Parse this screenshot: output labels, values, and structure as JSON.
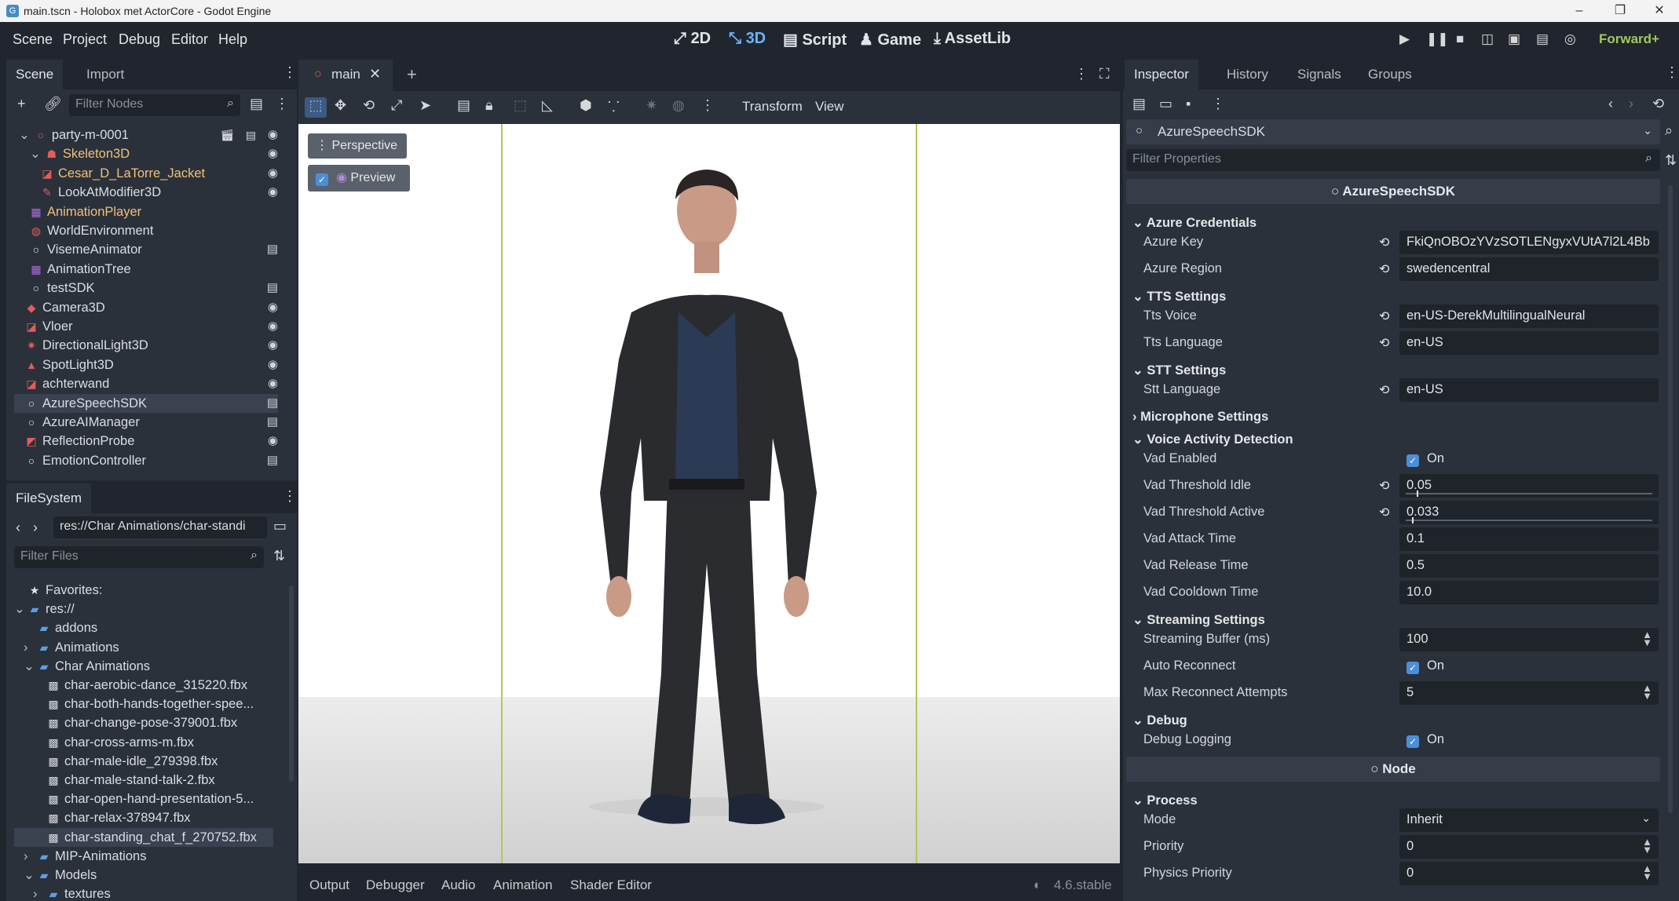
{
  "window": {
    "title": "main.tscn - Holobox met ActorCore - Godot Engine",
    "minimize": "–",
    "maximize": "❐",
    "close": "✕"
  },
  "menu": {
    "scene": "Scene",
    "project": "Project",
    "debug": "Debug",
    "editor": "Editor",
    "help": "Help"
  },
  "workspaces": {
    "d2": "2D",
    "d3": "3D",
    "script": "Script",
    "game": "Game",
    "assetlib": "AssetLib"
  },
  "renderer": "Forward+",
  "scene_dock": {
    "tab_scene": "Scene",
    "tab_import": "Import",
    "filter_placeholder": "Filter Nodes",
    "nodes": [
      {
        "label": "party-m-0001",
        "color": "#dadde2",
        "icon": "○",
        "icon_color": "#e25c5c"
      },
      {
        "label": "Skeleton3D",
        "color": "#f0c078",
        "icon": "☗",
        "icon_color": "#e25c5c"
      },
      {
        "label": "Cesar_D_LaTorre_Jacket",
        "color": "#f0c078",
        "icon": "◪",
        "icon_color": "#e25c5c"
      },
      {
        "label": "LookAtModifier3D",
        "color": "#dadde2",
        "icon": "✎",
        "icon_color": "#e25c5c"
      },
      {
        "label": "AnimationPlayer",
        "color": "#f0c078",
        "icon": "▦",
        "icon_color": "#b06ae0"
      },
      {
        "label": "WorldEnvironment",
        "color": "#dadde2",
        "icon": "◍",
        "icon_color": "#e25c5c"
      },
      {
        "label": "VisemeAnimator",
        "color": "#dadde2",
        "icon": "○",
        "icon_color": "#e6e6e6"
      },
      {
        "label": "AnimationTree",
        "color": "#dadde2",
        "icon": "▦",
        "icon_color": "#b06ae0"
      },
      {
        "label": "testSDK",
        "color": "#dadde2",
        "icon": "○",
        "icon_color": "#e6e6e6"
      },
      {
        "label": "Camera3D",
        "color": "#dadde2",
        "icon": "◆",
        "icon_color": "#e25c5c"
      },
      {
        "label": "Vloer",
        "color": "#dadde2",
        "icon": "◪",
        "icon_color": "#e25c5c"
      },
      {
        "label": "DirectionalLight3D",
        "color": "#dadde2",
        "icon": "✷",
        "icon_color": "#e25c5c"
      },
      {
        "label": "SpotLight3D",
        "color": "#dadde2",
        "icon": "▲",
        "icon_color": "#e25c5c"
      },
      {
        "label": "achterwand",
        "color": "#dadde2",
        "icon": "◪",
        "icon_color": "#e25c5c"
      },
      {
        "label": "AzureSpeechSDK",
        "color": "#dadde2",
        "icon": "○",
        "icon_color": "#e6e6e6"
      },
      {
        "label": "AzureAIManager",
        "color": "#dadde2",
        "icon": "○",
        "icon_color": "#e6e6e6"
      },
      {
        "label": "ReflectionProbe",
        "color": "#dadde2",
        "icon": "◩",
        "icon_color": "#e25c5c"
      },
      {
        "label": "EmotionController",
        "color": "#dadde2",
        "icon": "○",
        "icon_color": "#e6e6e6"
      }
    ]
  },
  "filesystem": {
    "tab": "FileSystem",
    "path": "res://Char Animations/char-standi",
    "filter_placeholder": "Filter Files",
    "items": [
      {
        "label": "Favorites:",
        "icon": "★"
      },
      {
        "label": "res://",
        "icon": "▰"
      },
      {
        "label": "addons",
        "icon": "▰"
      },
      {
        "label": "Animations",
        "icon": "▰"
      },
      {
        "label": "Char Animations",
        "icon": "▰"
      },
      {
        "label": "char-aerobic-dance_315220.fbx",
        "icon": "▩"
      },
      {
        "label": "char-both-hands-together-spee...",
        "icon": "▩"
      },
      {
        "label": "char-change-pose-379001.fbx",
        "icon": "▩"
      },
      {
        "label": "char-cross-arms-m.fbx",
        "icon": "▩"
      },
      {
        "label": "char-male-idle_279398.fbx",
        "icon": "▩"
      },
      {
        "label": "char-male-stand-talk-2.fbx",
        "icon": "▩"
      },
      {
        "label": "char-open-hand-presentation-5...",
        "icon": "▩"
      },
      {
        "label": "char-relax-378947.fbx",
        "icon": "▩"
      },
      {
        "label": "char-standing_chat_f_270752.fbx",
        "icon": "▩"
      },
      {
        "label": "MIP-Animations",
        "icon": "▰"
      },
      {
        "label": "Models",
        "icon": "▰"
      },
      {
        "label": "textures",
        "icon": "▰"
      }
    ]
  },
  "editor_tabs": {
    "main": "main",
    "add": "+"
  },
  "viewport": {
    "transform": "Transform",
    "view": "View",
    "perspective": "Perspective",
    "preview": "Preview"
  },
  "bottom_panel": {
    "output": "Output",
    "debugger": "Debugger",
    "audio": "Audio",
    "animation": "Animation",
    "shader_editor": "Shader Editor",
    "version": "4.6.stable"
  },
  "inspector": {
    "tab_inspector": "Inspector",
    "tab_history": "History",
    "tab_signals": "Signals",
    "tab_groups": "Groups",
    "object": "AzureSpeechSDK",
    "filter_placeholder": "Filter Properties",
    "category": "AzureSpeechSDK",
    "category_node": "Node",
    "sections": {
      "azure": "Azure Credentials",
      "tts": "TTS Settings",
      "stt": "STT Settings",
      "mic": "Microphone Settings",
      "vad": "Voice Activity Detection",
      "stream": "Streaming Settings",
      "debug": "Debug",
      "process": "Process"
    },
    "props": {
      "azure_key": {
        "label": "Azure Key",
        "value": "FkiQnOBOzYVzSOTLENgyxVUtA7l2L4Bb"
      },
      "azure_region": {
        "label": "Azure Region",
        "value": "swedencentral"
      },
      "tts_voice": {
        "label": "Tts Voice",
        "value": "en-US-DerekMultilingualNeural"
      },
      "tts_language": {
        "label": "Tts Language",
        "value": "en-US"
      },
      "stt_language": {
        "label": "Stt Language",
        "value": "en-US"
      },
      "vad_enabled": {
        "label": "Vad Enabled",
        "value": "On"
      },
      "vad_idle": {
        "label": "Vad Threshold Idle",
        "value": "0.05"
      },
      "vad_active": {
        "label": "Vad Threshold Active",
        "value": "0.033"
      },
      "vad_attack": {
        "label": "Vad Attack Time",
        "value": "0.1"
      },
      "vad_release": {
        "label": "Vad Release Time",
        "value": "0.5"
      },
      "vad_cooldown": {
        "label": "Vad Cooldown Time",
        "value": "10.0"
      },
      "stream_buffer": {
        "label": "Streaming Buffer (ms)",
        "value": "100"
      },
      "auto_reconnect": {
        "label": "Auto Reconnect",
        "value": "On"
      },
      "max_reconnect": {
        "label": "Max Reconnect Attempts",
        "value": "5"
      },
      "debug_logging": {
        "label": "Debug Logging",
        "value": "On"
      },
      "mode": {
        "label": "Mode",
        "value": "Inherit"
      },
      "priority": {
        "label": "Priority",
        "value": "0"
      },
      "physics_priority": {
        "label": "Physics Priority",
        "value": "0"
      }
    }
  }
}
